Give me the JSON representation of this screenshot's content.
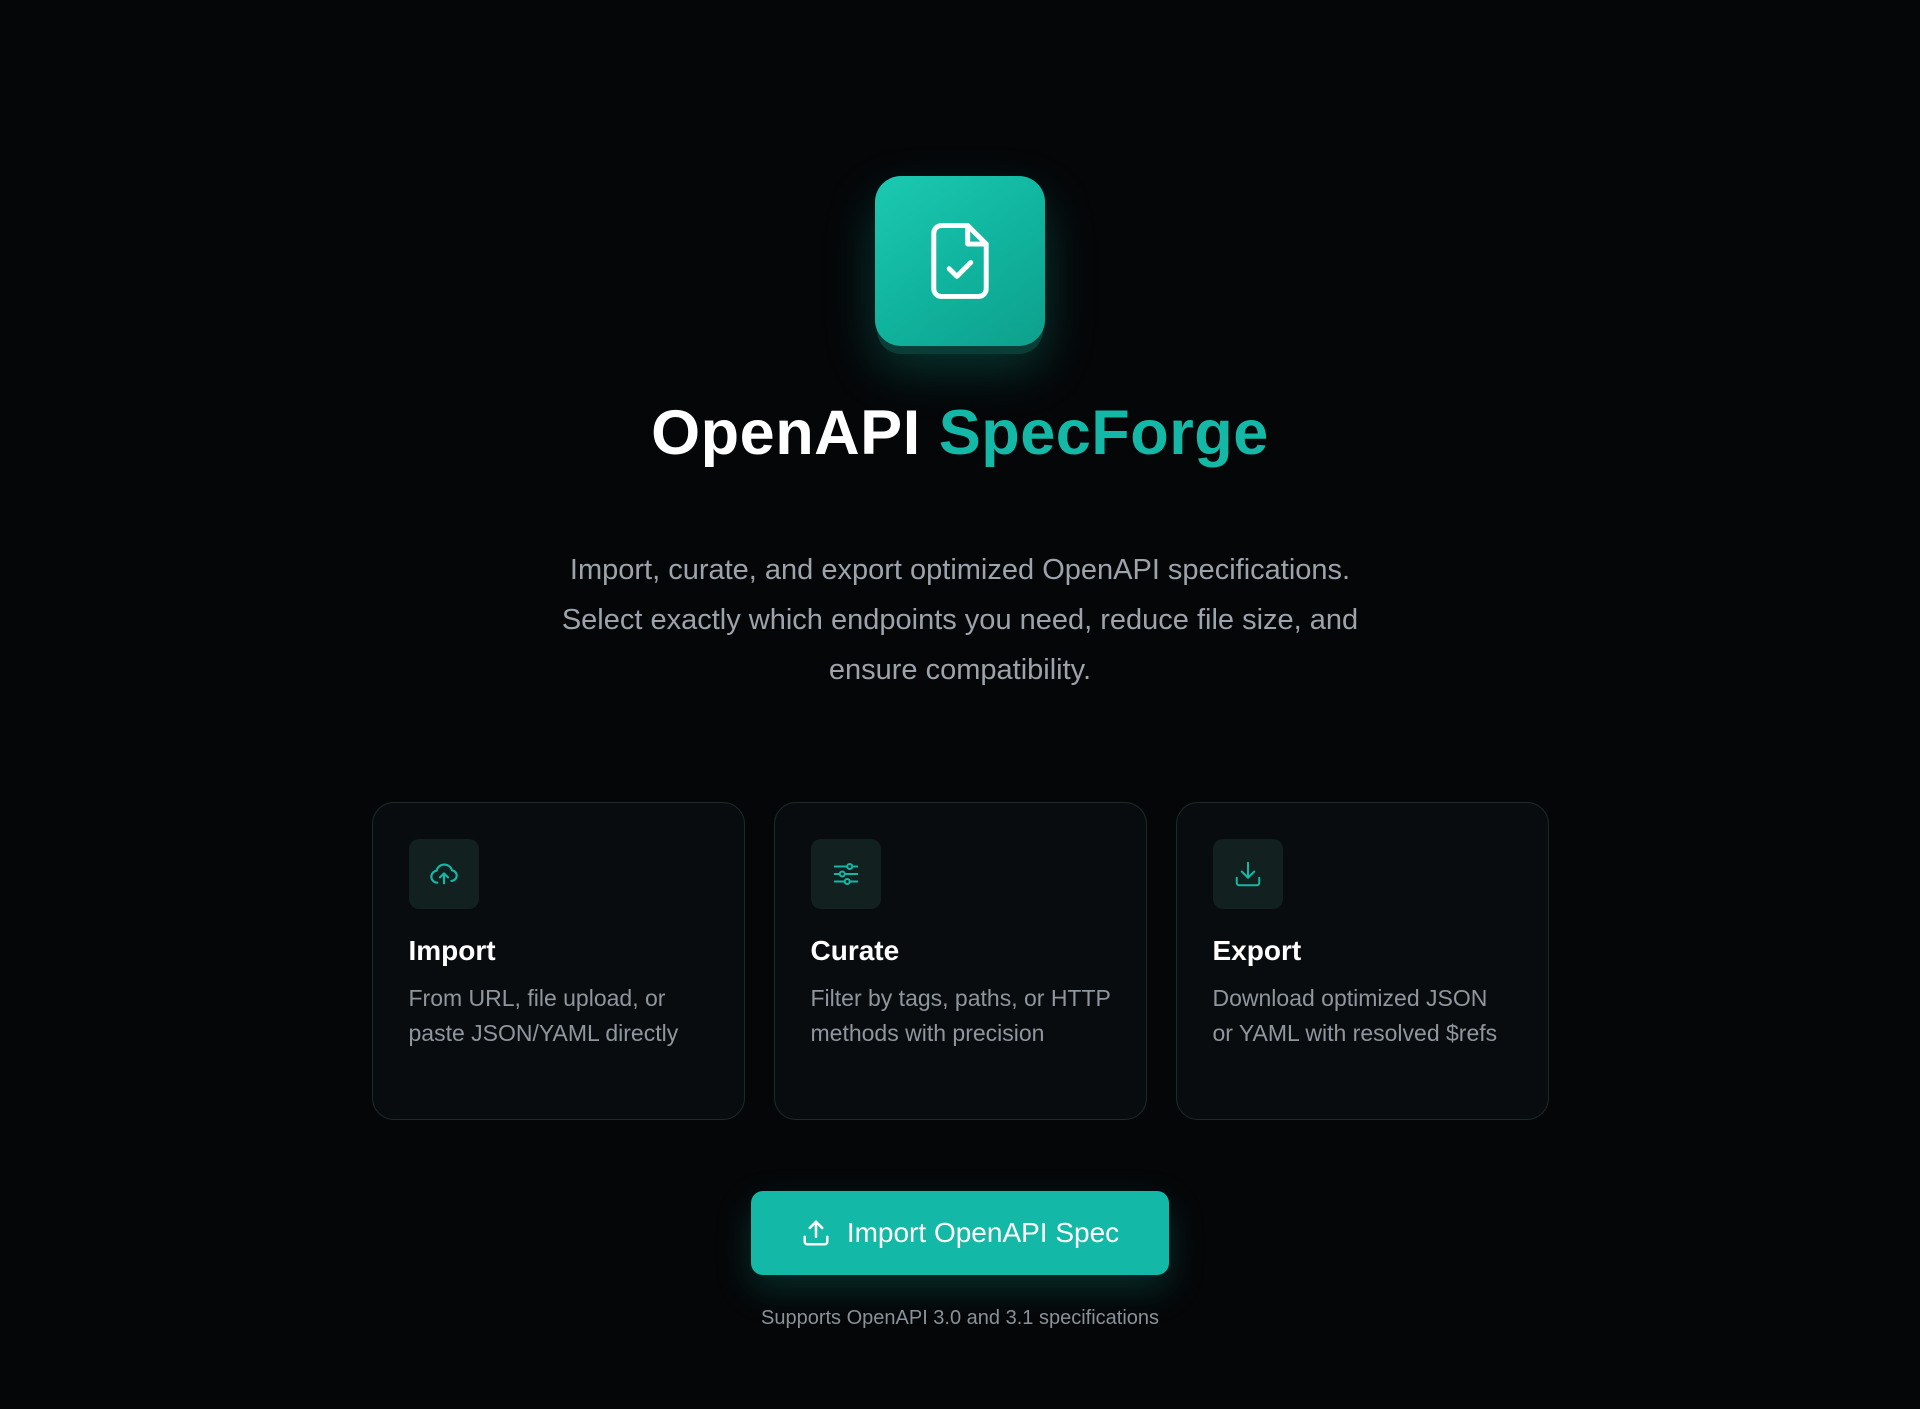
{
  "hero": {
    "title_main": "OpenAPI",
    "title_accent": "SpecForge",
    "subtitle_lines": [
      "Import, curate, and export optimized OpenAPI specifications.",
      "Select exactly which endpoints you need, reduce file size, and",
      "ensure compatibility."
    ]
  },
  "features": [
    {
      "icon": "cloud-upload-icon",
      "title": "Import",
      "description": "From URL, file upload, or paste JSON/YAML directly"
    },
    {
      "icon": "sliders-icon",
      "title": "Curate",
      "description": "Filter by tags, paths, or HTTP methods with precision"
    },
    {
      "icon": "download-icon",
      "title": "Export",
      "description": "Download optimized JSON or YAML with resolved $refs"
    }
  ],
  "cta": {
    "icon": "upload-icon",
    "label": "Import OpenAPI Spec"
  },
  "footnote": "Supports OpenAPI 3.0 and 3.1 specifications",
  "colors": {
    "background": "#050608",
    "accent": "#14b8a6",
    "card_border": "#1e2a2a",
    "muted_text": "#9ca3ab"
  }
}
